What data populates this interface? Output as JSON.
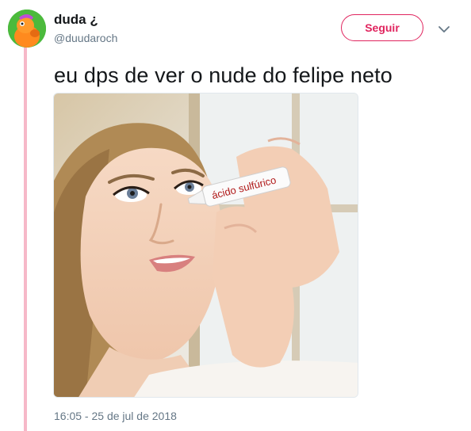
{
  "author": {
    "display_name": "duda ¿",
    "handle": "@duudaroch"
  },
  "follow_button": {
    "label": "Seguir"
  },
  "tweet": {
    "text": "eu dps de ver o nude do felipe neto",
    "timestamp": "16:05 - 25 de jul de 2018"
  },
  "media": {
    "bottle_label": "ácido sulfúrico"
  },
  "colors": {
    "accent": "#e0245e",
    "thread_line": "#f6b8c8",
    "secondary_text": "#657786",
    "primary_text": "#14171a"
  }
}
